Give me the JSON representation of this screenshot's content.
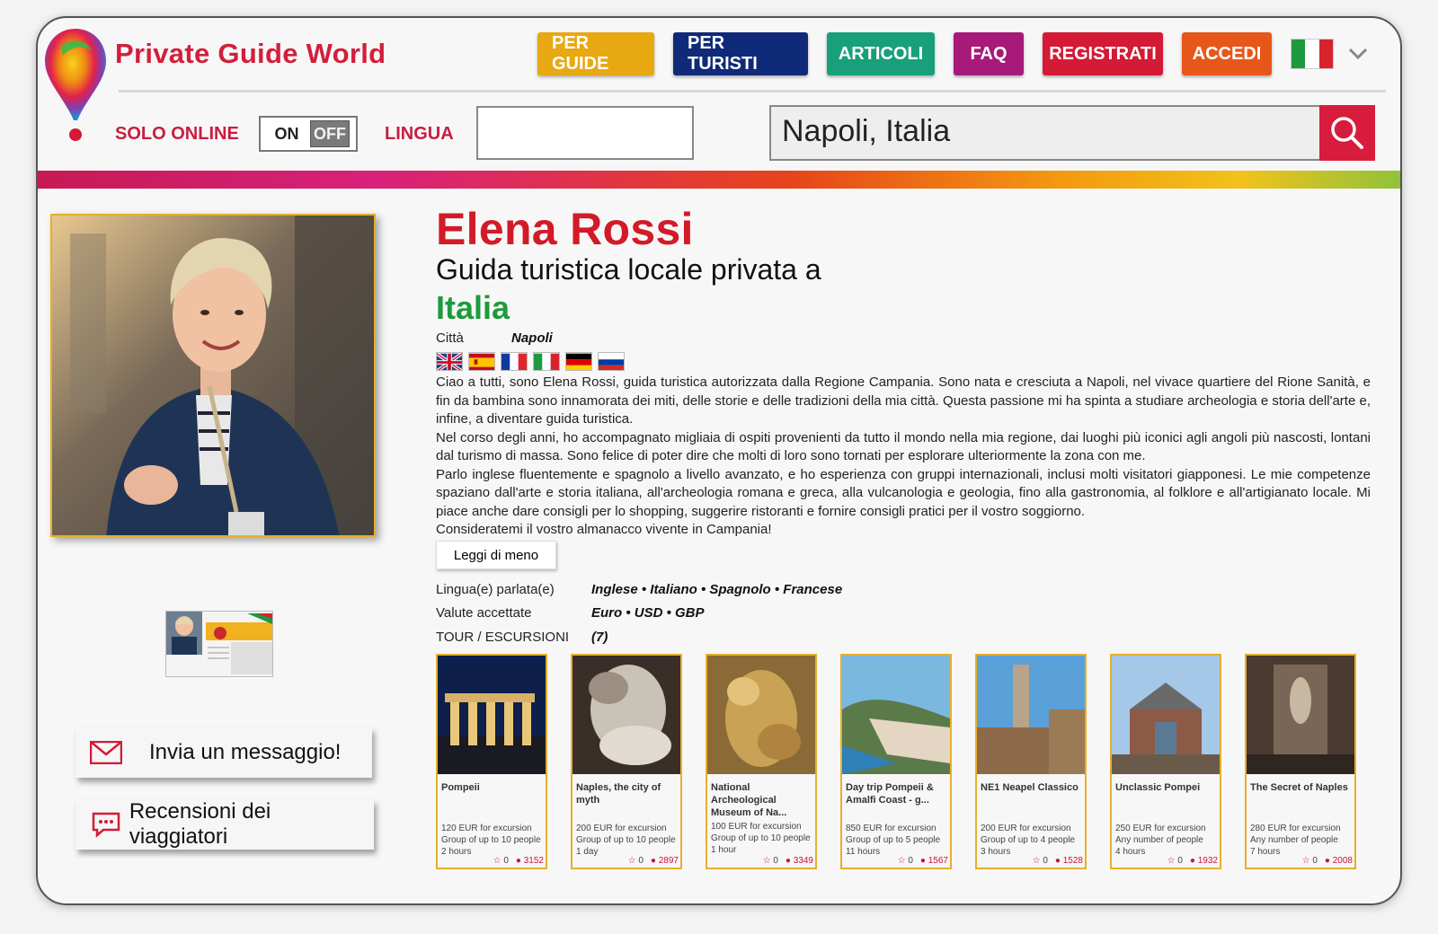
{
  "brand": {
    "name": "Private Guide World"
  },
  "nav": {
    "items": [
      {
        "label": "PER GUIDE",
        "color": "#e7a812"
      },
      {
        "label": "PER TURISTI",
        "color": "#0f2a78"
      },
      {
        "label": "ARTICOLI",
        "color": "#17a07a"
      },
      {
        "label": "FAQ",
        "color": "#a71a7a"
      },
      {
        "label": "REGISTRATI",
        "color": "#d41a35"
      },
      {
        "label": "ACCEDI",
        "color": "#e8571a"
      }
    ],
    "language_flag": "italy-flag-icon"
  },
  "filters": {
    "solo_online_label": "SOLO ONLINE",
    "toggle_on": "ON",
    "toggle_off": "OFF",
    "lingua_label": "LINGUA",
    "lingua_value": "",
    "search_value": "Napoli, Italia"
  },
  "profile": {
    "name": "Elena Rossi",
    "subtitle": "Guida turistica locale privata a",
    "country": "Italia",
    "city_label": "Città",
    "city": "Napoli",
    "language_flags": [
      "uk-flag-icon",
      "spain-flag-icon",
      "france-flag-icon",
      "italy-flag-icon",
      "germany-flag-icon",
      "russia-flag-icon"
    ],
    "bio": [
      "Ciao a tutti, sono Elena Rossi, guida turistica autorizzata dalla Regione Campania. Sono nata e cresciuta a Napoli, nel vivace quartiere del Rione Sanità, e fin da bambina sono innamorata dei miti, delle storie e delle tradizioni della mia città. Questa passione mi ha spinta a studiare archeologia e storia dell'arte e, infine, a diventare guida turistica.",
      "Nel corso degli anni, ho accompagnato migliaia di ospiti provenienti da tutto il mondo nella mia regione, dai luoghi più iconici agli angoli più nascosti, lontani dal turismo di massa. Sono felice di poter dire che molti di loro sono tornati per esplorare ulteriormente la zona con me.",
      "Parlo inglese fluentemente e spagnolo a livello avanzato, e ho esperienza con gruppi internazionali, inclusi molti visitatori giapponesi. Le mie competenze spaziano dall'arte e storia italiana, all'archeologia romana e greca, alla vulcanologia e geologia, fino alla gastronomia, al folklore e all'artigianato locale. Mi piace anche dare consigli per lo shopping, suggerire ristoranti e fornire consigli pratici per il vostro soggiorno.",
      "Consideratemi il vostro almanacco vivente in Campania!"
    ],
    "read_less": "Leggi di meno",
    "languages_label": "Lingua(e) parlata(e)",
    "languages": "Inglese • Italiano • Spagnolo • Francese",
    "currencies_label": "Valute accettate",
    "currencies": "Euro • USD • GBP",
    "tours_label": "TOUR / ESCURSIONI",
    "tours_count": "(7)",
    "badge_text": "GUIDA TURISTICA"
  },
  "actions": {
    "message": "Invia un messaggio!",
    "reviews": "Recensioni dei viaggiatori"
  },
  "tours": [
    {
      "title": "Pompeii",
      "price": "120 EUR for excursion",
      "group": "Group of up to 10 people",
      "duration": "2 hours",
      "rating": "0",
      "views": "3152"
    },
    {
      "title": "Naples, the city of myth",
      "price": "200 EUR for excursion",
      "group": "Group of up to 10 people",
      "duration": "1 day",
      "rating": "0",
      "views": "2897"
    },
    {
      "title": "National Archeological Museum of Na...",
      "price": "100 EUR for excursion",
      "group": "Group of up to 10 people",
      "duration": "1 hour",
      "rating": "0",
      "views": "3349"
    },
    {
      "title": "Day trip Pompeii & Amalfi Coast - g...",
      "price": "850 EUR for excursion",
      "group": "Group of up to 5 people",
      "duration": "11 hours",
      "rating": "0",
      "views": "1567"
    },
    {
      "title": "NE1 Neapel Classico",
      "price": "200 EUR for excursion",
      "group": "Group of up to 4 people",
      "duration": "3 hours",
      "rating": "0",
      "views": "1528"
    },
    {
      "title": "Unclassic Pompei",
      "price": "250 EUR for excursion",
      "group": "Any number of people",
      "duration": "4 hours",
      "rating": "0",
      "views": "1932"
    },
    {
      "title": "The Secret of Naples",
      "price": "280 EUR for excursion",
      "group": "Any number of people",
      "duration": "7 hours",
      "rating": "0",
      "views": "2008"
    }
  ]
}
